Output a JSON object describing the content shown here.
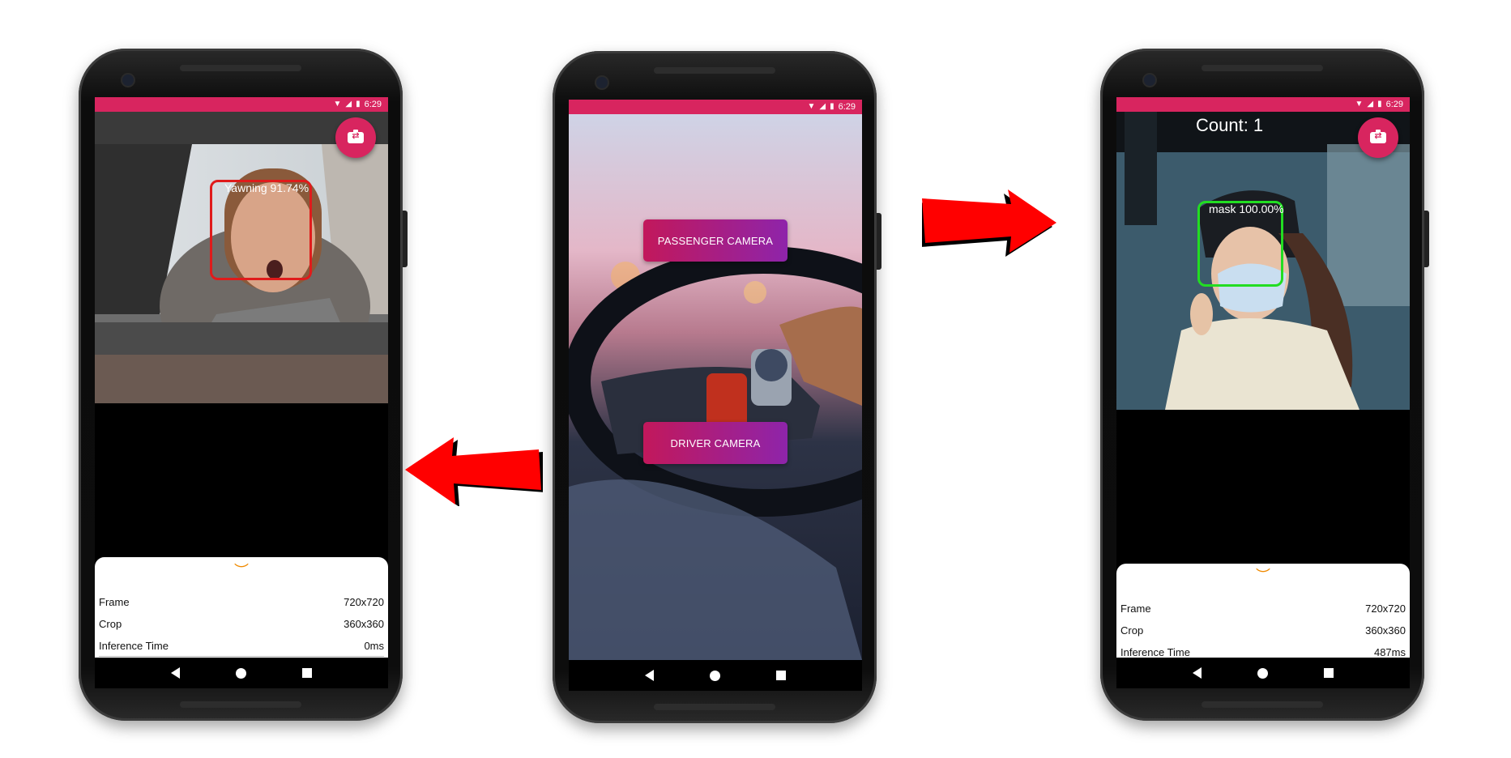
{
  "status_bar": {
    "time": "6:29",
    "wifi_icon": "wifi-icon",
    "signal_icon": "signal-icon",
    "battery_icon": "battery-icon"
  },
  "left_phone": {
    "detection_label": "Yawning 91.74%",
    "box_color": "#e01b1b",
    "panel": {
      "rows": [
        {
          "label": "Frame",
          "value": "720x720"
        },
        {
          "label": "Crop",
          "value": "360x360"
        },
        {
          "label": "Inference Time",
          "value": "0ms"
        }
      ]
    }
  },
  "center_phone": {
    "passenger_button": "PASSENGER CAMERA",
    "driver_button": "DRIVER CAMERA"
  },
  "right_phone": {
    "count_label": "Count: 1",
    "detection_label": "mask 100.00%",
    "box_color": "#22dd22",
    "panel": {
      "rows": [
        {
          "label": "Frame",
          "value": "720x720"
        },
        {
          "label": "Crop",
          "value": "360x360"
        },
        {
          "label": "Inference Time",
          "value": "487ms"
        }
      ]
    }
  },
  "colors": {
    "accent": "#d8255f",
    "arrow": "#ff0000",
    "chevron": "#f08a00"
  },
  "icons": {
    "fab": "switch-camera-icon",
    "chevron": "chevron-down-icon",
    "nav": [
      "back-icon",
      "home-icon",
      "recents-icon"
    ]
  }
}
